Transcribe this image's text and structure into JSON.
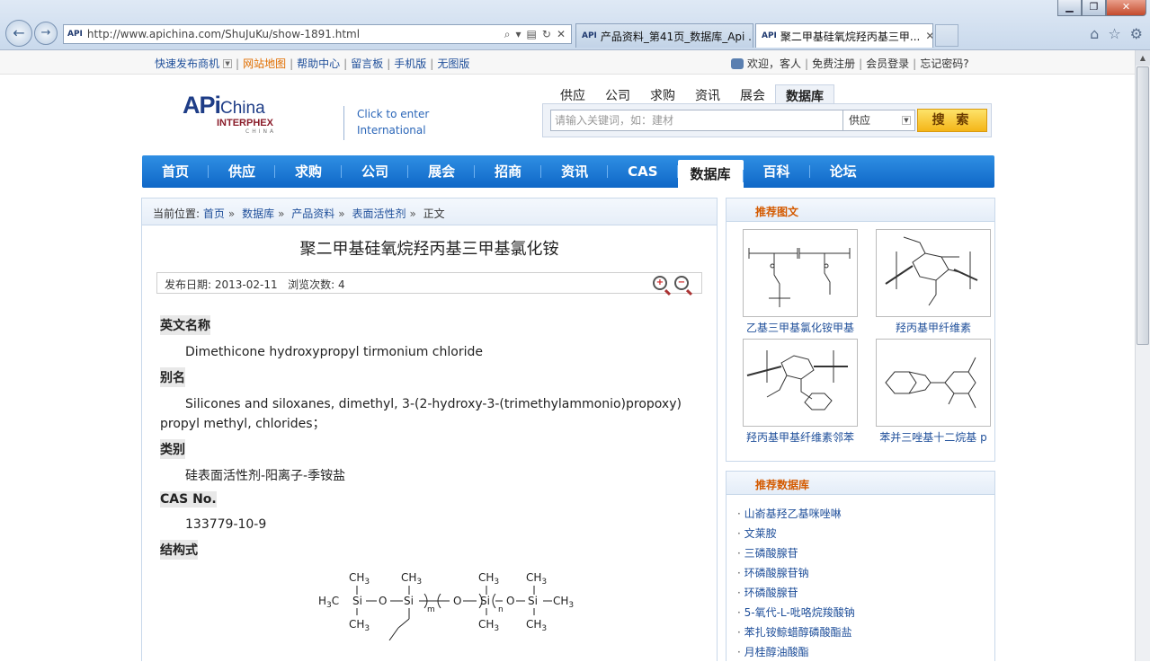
{
  "browser": {
    "url": "http://www.apichina.com/ShuJuKu/show-1891.html",
    "favicon": "API",
    "tabs": [
      {
        "label": "产品资料_第41页_数据库_Api ...",
        "active": false
      },
      {
        "label": "聚二甲基硅氧烷羟丙基三甲...",
        "active": true
      }
    ]
  },
  "topbar": {
    "quick_publish": "快速发布商机",
    "links": [
      "网站地图",
      "帮助中心",
      "留言板",
      "手机版",
      "无图版"
    ],
    "welcome": "欢迎，客人",
    "register": "免费注册",
    "login": "会员登录",
    "forgot": "忘记密码?"
  },
  "header": {
    "logo_api": "APi",
    "logo_china": "China",
    "logo_interphex": "INTERPHEX",
    "logo_sub": "CHINA",
    "intl_line1": "Click to enter",
    "intl_line2": "International",
    "search_tabs": [
      "供应",
      "公司",
      "求购",
      "资讯",
      "展会",
      "数据库"
    ],
    "search_placeholder": "请输入关键词，如：建材",
    "search_select": "供应",
    "search_button": "搜 索"
  },
  "nav": {
    "items": [
      "首页",
      "供应",
      "求购",
      "公司",
      "展会",
      "招商",
      "资讯",
      "CAS",
      "数据库",
      "百科",
      "论坛"
    ],
    "active": "数据库"
  },
  "breadcrumb": {
    "prefix": "当前位置:",
    "items": [
      "首页",
      "数据库",
      "产品资料",
      "表面活性剂",
      "正文"
    ]
  },
  "article": {
    "title": "聚二甲基硅氧烷羟丙基三甲基氯化铵",
    "publish_label": "发布日期:",
    "publish_date": "2013-02-11",
    "views_label": "浏览次数:",
    "views": "4",
    "sections": [
      {
        "heading": "英文名称",
        "text": "Dimethicone hydroxypropyl tirmonium chloride"
      },
      {
        "heading": "别名",
        "text": "Silicones and siloxanes, dimethyl, 3-(2-hydroxy-3-(trimethylammonio)propoxy) propyl methyl, chlorides；"
      },
      {
        "heading": "类别",
        "text": "硅表面活性剂-阳离子-季铵盐"
      },
      {
        "heading": "CAS No.",
        "text": "133779-10-9"
      },
      {
        "heading": "结构式",
        "text": ""
      }
    ],
    "structure_labels": {
      "h3c": "H",
      "c3": "C",
      "si": "Si",
      "o": "O",
      "ch3": "CH",
      "three": "3",
      "m": "m",
      "n": "n"
    }
  },
  "sidebar": {
    "images_title": "推荐图文",
    "images": [
      {
        "caption": "乙基三甲基氯化铵甲基"
      },
      {
        "caption": "羟丙基甲纤维素"
      },
      {
        "caption": "羟丙基甲基纤维素邻苯"
      },
      {
        "caption": "苯并三唑基十二烷基 p"
      }
    ],
    "db_title": "推荐数据库",
    "db_items": [
      "山嵛基羟乙基咪唑啉",
      "文莱胺",
      "三磷酸腺苷",
      "环磷酸腺苷钠",
      "环磷酸腺苷",
      "5-氧代-L-吡咯烷羧酸钠",
      "苯扎铵鲸蜡醇磷酸酯盐",
      "月桂醇油酸酯"
    ]
  }
}
